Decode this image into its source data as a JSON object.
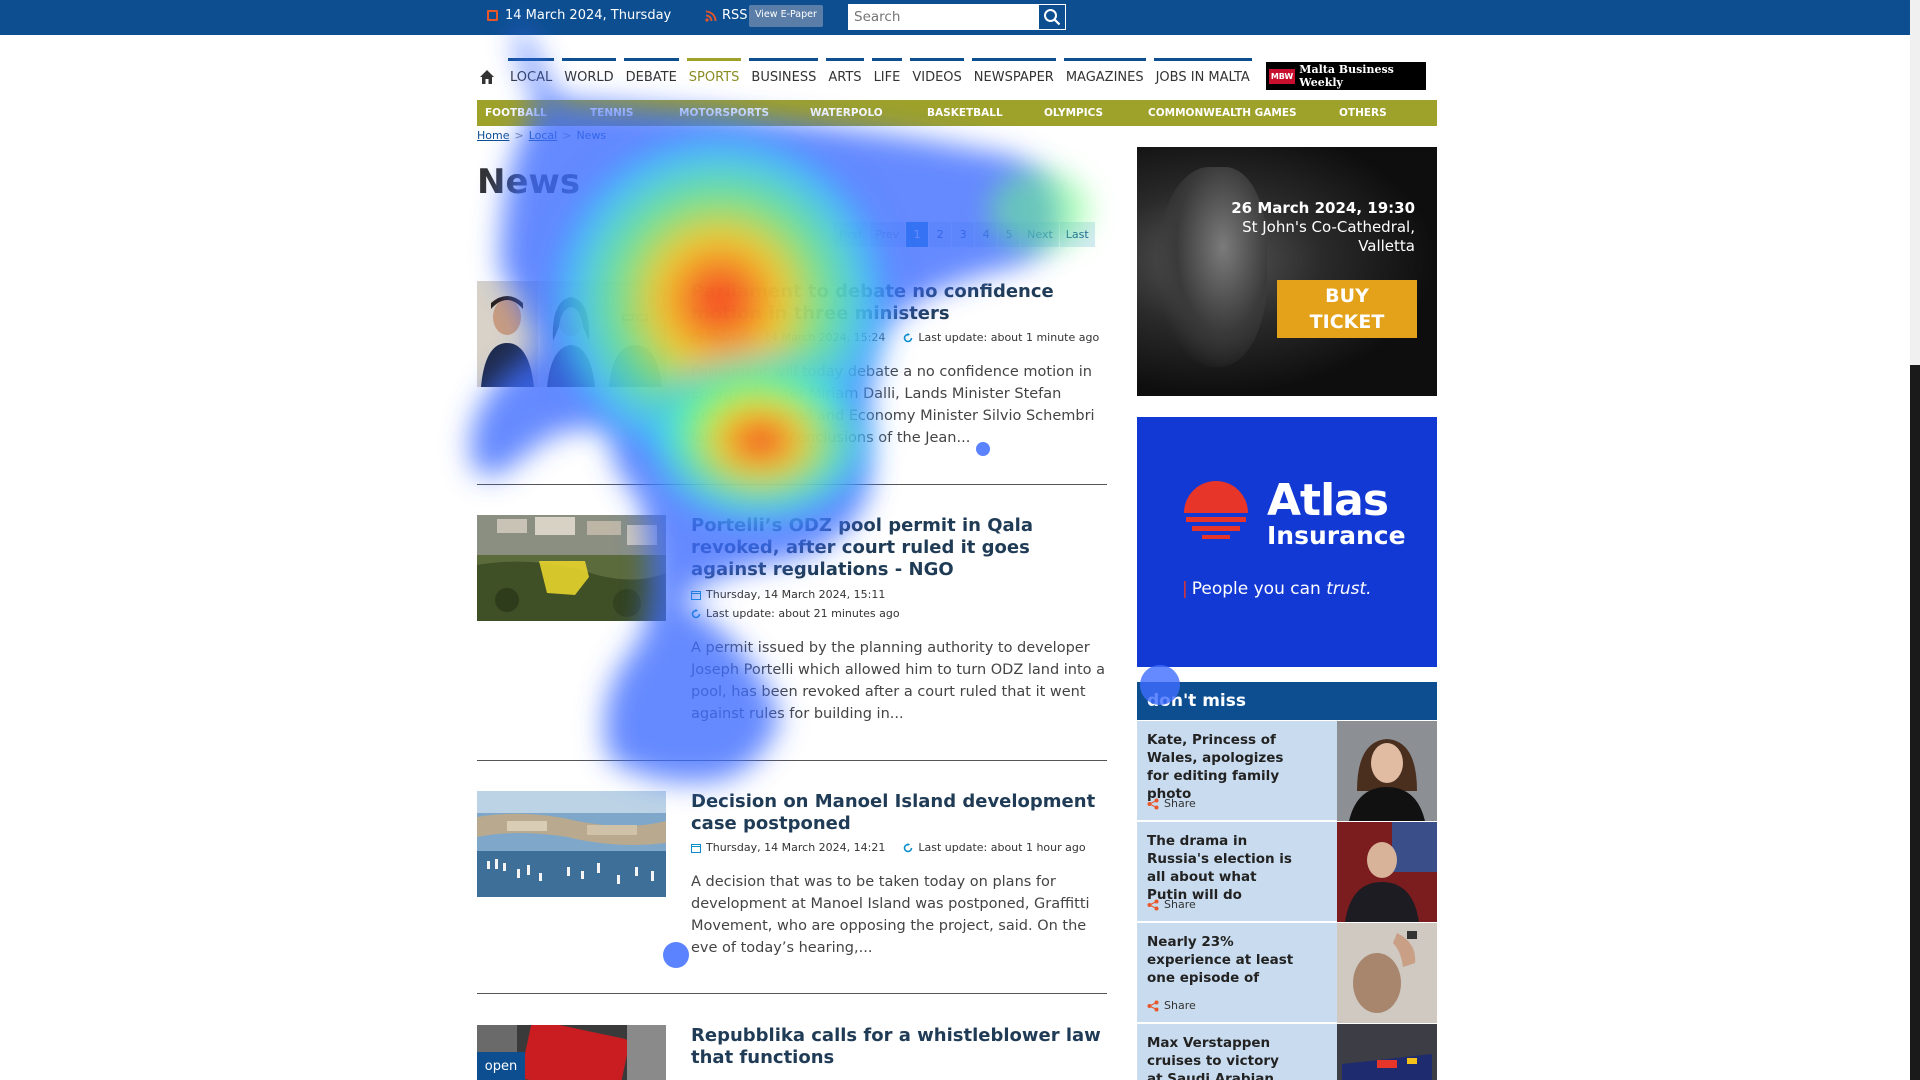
{
  "topbar": {
    "date": "14 March 2024, Thursday",
    "rss_label": "RSS",
    "epaper_label": "View E-Paper",
    "search_placeholder": "Search"
  },
  "mainnav": {
    "items": [
      "LOCAL",
      "WORLD",
      "DEBATE",
      "SPORTS",
      "BUSINESS",
      "ARTS",
      "LIFE",
      "VIDEOS",
      "NEWSPAPER",
      "MAGAZINES",
      "JOBS IN MALTA"
    ],
    "mbw_logo": "MBW",
    "mbw_label": "Malta Business Weekly"
  },
  "subnav": {
    "items": [
      "FOOTBALL",
      "TENNIS",
      "MOTORSPORTS",
      "WATERPOLO",
      "BASKETBALL",
      "OLYMPICS",
      "COMMONWEALTH GAMES",
      "OTHERS"
    ]
  },
  "breadcrumb": {
    "home": "Home",
    "local": "Local",
    "current": "News",
    "sep": ">"
  },
  "page_title": "News",
  "pager": [
    "First",
    "Prev",
    "1",
    "2",
    "3",
    "4",
    "5",
    "Next",
    "Last"
  ],
  "articles": [
    {
      "title": "Parliament to debate no confidence motion in three ministers",
      "date": "Thursday, 14 March 2024, 15:24",
      "updated": "Last update: about 1 minute ago",
      "excerpt": "Parliament will today debate a no confidence motion in Energy Minister Miriam Dalli, Lands Minister Stefan Zrinzo Azzopardi and Economy Minister Silvio Schembri following the conclusions of the Jean..."
    },
    {
      "title": "Portelli’s ODZ pool permit in Qala revoked, after court ruled it goes against regulations - NGO",
      "date": "Thursday, 14 March 2024, 15:11",
      "updated": "Last update: about 21 minutes ago",
      "excerpt": "A permit issued by the planning authority to developer Joseph Portelli which allowed him to turn ODZ land into a pool, has been revoked after a court ruled that it went against rules for building in..."
    },
    {
      "title": "Decision on Manoel Island development case postponed",
      "date": "Thursday, 14 March 2024, 14:21",
      "updated": "Last update: about 1 hour ago",
      "excerpt": "A decision that was to be taken today on plans for development at Manoel Island was postponed, Graffitti Movement, who are opposing the project, said. On the eve of today’s hearing,..."
    },
    {
      "title": "Repubblika calls for a whistleblower law that functions"
    }
  ],
  "ad_concert": {
    "date": "26 March 2024, 19:30",
    "venue_line1": "St John's Co-Cathedral,",
    "venue_line2": "Valletta",
    "button_line1": "BUY",
    "button_line2": "TICKET"
  },
  "ad_atlas": {
    "name": "Atlas",
    "sub": "Insurance",
    "tagline_plain": "People you can ",
    "tagline_italic": "trust."
  },
  "dont_miss": {
    "heading": "don't miss",
    "share_label": "Share",
    "items": [
      "Kate, Princess of Wales, apologizes for editing family photo",
      "The drama in Russia's election is all about what Putin will do",
      "Nearly 23% experience at least one episode of",
      "Max Verstappen cruises to victory at Saudi Arabian GP to"
    ]
  },
  "open_label": "open",
  "colors": {
    "topbar": "#0d4e91",
    "sports_accent": "#9ea12a",
    "ticket_button": "#e3a21a",
    "atlas_blue": "#1339d4",
    "dont_miss_bg": "#c9dcef"
  }
}
